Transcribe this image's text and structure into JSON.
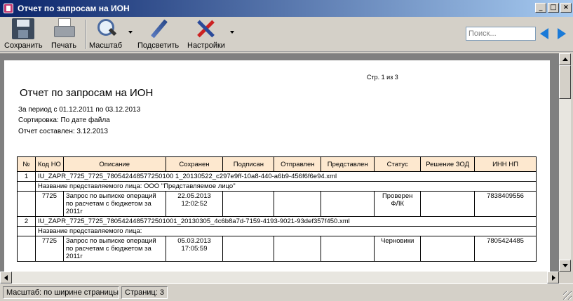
{
  "window": {
    "title": "Отчет по запросам на ИОН",
    "min": "_",
    "max": "□",
    "close": "×"
  },
  "toolbar": {
    "save": "Сохранить",
    "print": "Печать",
    "zoom": "Масштаб",
    "highlight": "Подсветить",
    "settings": "Настройки",
    "search_placeholder": "Поиск..."
  },
  "report": {
    "page_indicator": "Стр. 1 из 3",
    "title": "Отчет по запросам на ИОН",
    "period": "За период с 01.12.2011 по 03.12.2013",
    "sort": "Сортировка: По дате файла",
    "created": "Отчет составлен: 3.12.2013",
    "columns": [
      "№",
      "Код НО",
      "Описание",
      "Сохранен",
      "Подписан",
      "Отправлен",
      "Представлен",
      "Статус",
      "Решение ЗОД",
      "ИНН НП"
    ],
    "rows": [
      {
        "num": "1",
        "file": "IU_ZAPR_7725_7725_780542448577250100 1_20130522_c297e9ff-10a8-440-a6b9-456f6f6e94.xml",
        "person": "Название представляемого лица: ООО \"Представляемое лицо\"",
        "code": "7725",
        "desc": "Запрос по выписке операций по расчетам с бюджетом за 2011г",
        "saved_date": "22.05.2013",
        "saved_time": "12:02:52",
        "signed": "",
        "sent": "",
        "presented": "",
        "status": "Проверен ФЛК",
        "decision": "",
        "inn": "7838409556"
      },
      {
        "num": "2",
        "file": "IU_ZAPR_7725_7725_7805424485772501001_20130305_4c6b8a7d-7159-4193-9021-93def357f450.xml",
        "person": "Название представляемого лица:",
        "code": "7725",
        "desc": "Запрос по выписке операций по расчетам с бюджетом за 2011г",
        "saved_date": "05.03.2013",
        "saved_time": "17:05:59",
        "signed": "",
        "sent": "",
        "presented": "",
        "status": "Черновики",
        "decision": "",
        "inn": "7805424485"
      }
    ]
  },
  "status": {
    "zoom": "Масштаб: по ширине страницы",
    "pages": "Страниц: 3"
  }
}
